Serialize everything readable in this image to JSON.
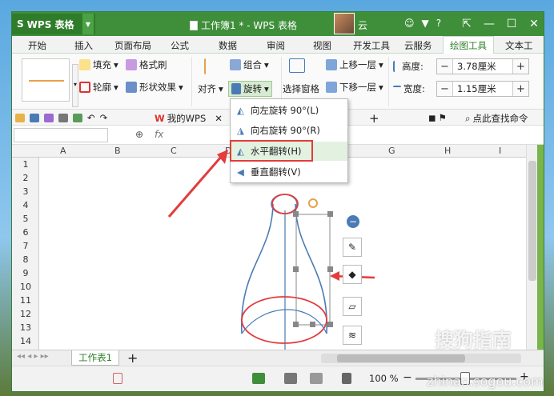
{
  "app": {
    "name": "WPS 表格",
    "window_title": "工作簿1 * - WPS 表格",
    "user": "云"
  },
  "tabs": [
    "开始",
    "插入",
    "页面布局",
    "公式",
    "数据",
    "审阅",
    "视图",
    "开发工具",
    "云服务",
    "绘图工具",
    "文本工"
  ],
  "active_tab": "绘图工具",
  "ribbon": {
    "fill": "填充",
    "format_brush": "格式刷",
    "outline": "轮廓",
    "shape_effect": "形状效果",
    "align": "对齐",
    "group": "组合",
    "rotate": "旋转",
    "selection_pane": "选择窗格",
    "bring_forward": "上移一层",
    "send_backward": "下移一层",
    "height_label": "高度:",
    "height_value": "3.78厘米",
    "width_label": "宽度:",
    "width_value": "1.15厘米"
  },
  "quickbar": {
    "mywps": "我的WPS",
    "search": "点此查找命令"
  },
  "formula_bar": {
    "fx": "fx"
  },
  "columns": [
    "A",
    "B",
    "C",
    "D",
    "E",
    "F",
    "G",
    "H",
    "I"
  ],
  "rows": [
    "1",
    "2",
    "3",
    "4",
    "5",
    "6",
    "7",
    "8",
    "9",
    "10",
    "11",
    "12",
    "13",
    "14"
  ],
  "rotate_menu": {
    "rotate_left": "向左旋转 90°(L)",
    "rotate_right": "向右旋转 90°(R)",
    "flip_horizontal": "水平翻转(H)",
    "flip_vertical": "垂直翻转(V)"
  },
  "sheet_tab": "工作表1",
  "status": {
    "zoom": "100 %"
  },
  "watermark": {
    "text": "搜狗指南",
    "url": "zhinan.sogou.com"
  },
  "colors": {
    "accent": "#3f8f3a",
    "annotation_red": "#e23c3c",
    "shape_stroke": "#4a7bb5",
    "highlight": "#e3f1e0"
  }
}
